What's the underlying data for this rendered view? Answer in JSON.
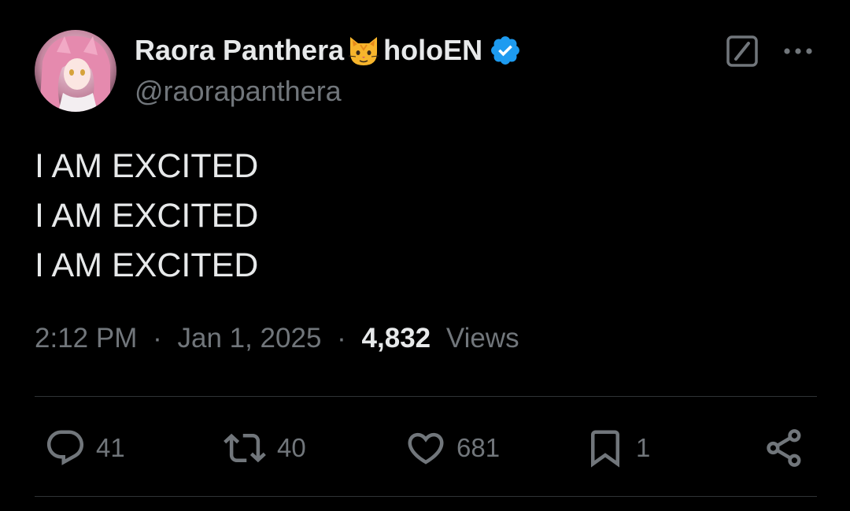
{
  "author": {
    "display_name": "Raora Panthera",
    "name_suffix": "holoEN",
    "handle": "@raorapanthera",
    "verified": true,
    "emoji_icon": "cat-face-icon",
    "avatar_icon": "avatar-image"
  },
  "header_actions": {
    "grok_icon": "grok-icon",
    "more_icon": "more-options-icon"
  },
  "tweet": {
    "lines": [
      "I AM EXCITED",
      "I AM EXCITED",
      "I AM EXCITED"
    ]
  },
  "meta": {
    "time": "2:12 PM",
    "date": "Jan 1, 2025",
    "separator": "·",
    "views_count": "4,832",
    "views_label": "Views"
  },
  "actions": {
    "reply_count": "41",
    "retweet_count": "40",
    "like_count": "681",
    "bookmark_count": "1"
  },
  "colors": {
    "background": "#000000",
    "primary_text": "#e7e9ea",
    "secondary_text": "#71767b",
    "divider": "#2f3336",
    "verified_blue": "#1d9bf0"
  }
}
